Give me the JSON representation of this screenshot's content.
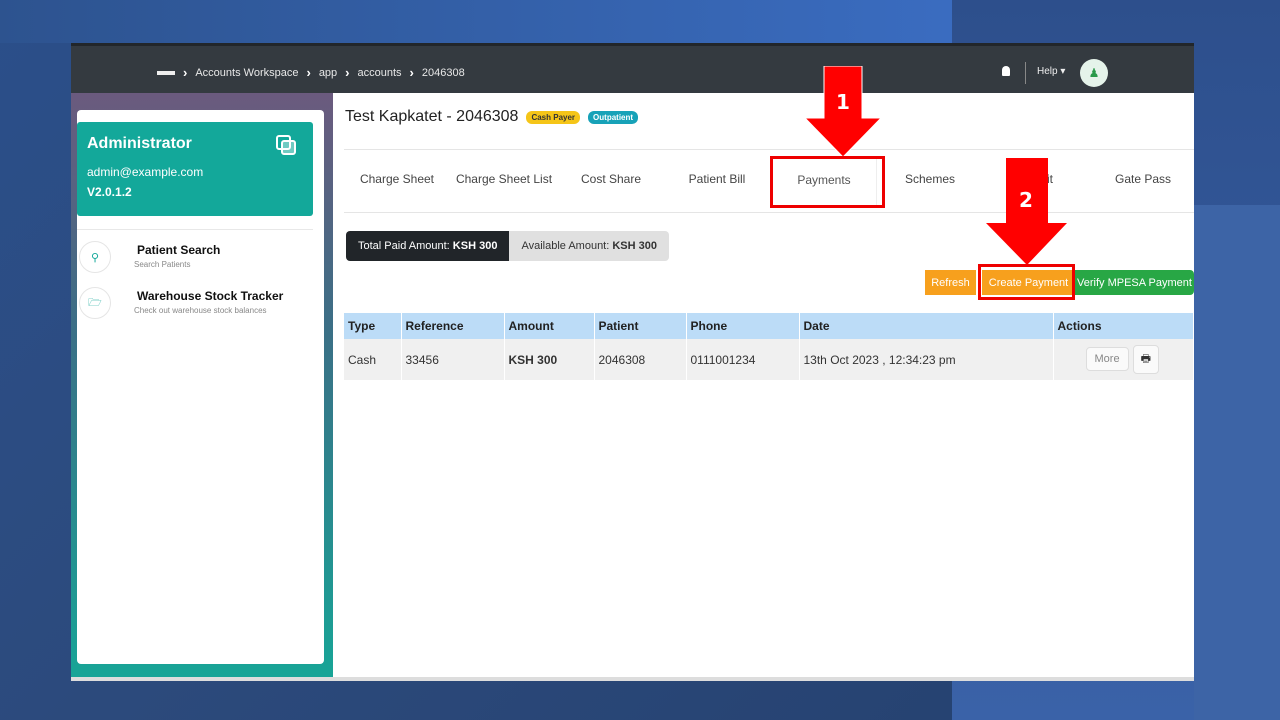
{
  "breadcrumb": [
    "Accounts Workspace",
    "app",
    "accounts",
    "2046308"
  ],
  "header": {
    "help": "Help"
  },
  "sidebar": {
    "user": {
      "name": "Administrator",
      "email": "admin@example.com",
      "version": "V2.0.1.2"
    },
    "items": [
      {
        "label": "Patient Search",
        "sub": "Search Patients",
        "icon": "search-icon"
      },
      {
        "label": "Warehouse Stock Tracker",
        "sub": "Check out warehouse stock balances",
        "icon": "folder-open-icon"
      }
    ]
  },
  "main": {
    "title": "Test Kapkatet - 2046308",
    "badges": [
      "Cash Payer",
      "Outpatient"
    ],
    "tabs": [
      "Charge Sheet",
      "Charge Sheet List",
      "Cost Share",
      "Patient Bill",
      "Payments",
      "Schemes",
      "Credit",
      "Gate Pass"
    ],
    "active_tab": "Payments",
    "summary": {
      "paid_label": "Total Paid Amount:",
      "paid": "KSH 300",
      "avail_label": "Available Amount:",
      "avail": "KSH 300"
    },
    "buttons": {
      "refresh": "Refresh",
      "create": "Create Payment",
      "verify": "Verify MPESA Payment"
    },
    "table": {
      "headers": [
        "Type",
        "Reference",
        "Amount",
        "Patient",
        "Phone",
        "Date",
        "Actions"
      ],
      "rows": [
        {
          "type": "Cash",
          "reference": "33456",
          "amount": "KSH 300",
          "patient": "2046308",
          "phone": "0111001234",
          "date": "13th Oct 2023 , 12:34:23 pm",
          "more": "More"
        }
      ]
    }
  },
  "annotations": [
    "1",
    "2"
  ],
  "colors": {
    "teal": "#13a89a",
    "orange": "#f7a01d",
    "green": "#28a745",
    "annotation": "#e00000"
  }
}
